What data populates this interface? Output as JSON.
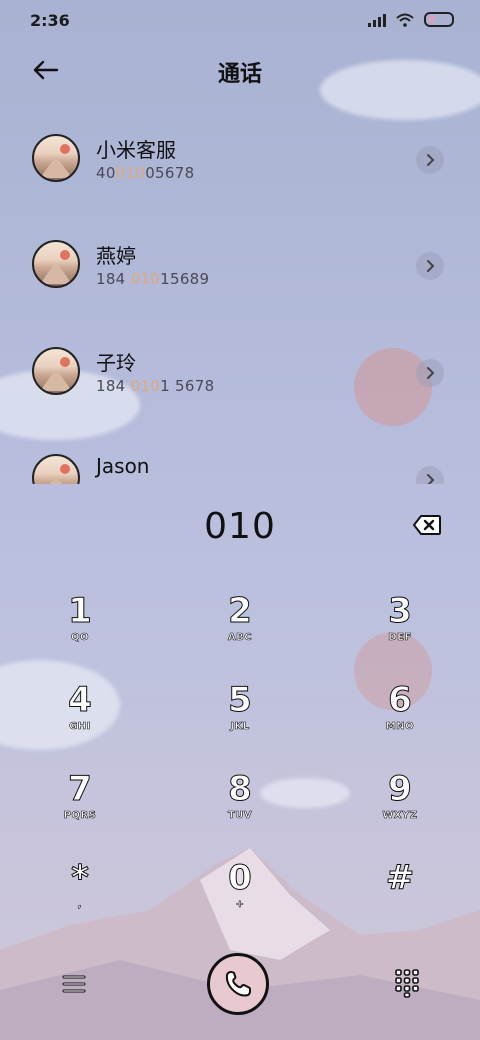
{
  "status": {
    "time": "2:36"
  },
  "header": {
    "title": "通话"
  },
  "contacts": [
    {
      "name": "小米客服",
      "num_pre": "40",
      "num_hl": "010",
      "num_post": "05678"
    },
    {
      "name": "燕婷",
      "num_pre": "184 ",
      "num_hl": "010",
      "num_post": "15689"
    },
    {
      "name": "子玲",
      "num_pre": "184 ",
      "num_hl": "010",
      "num_post": "1 5678"
    },
    {
      "name": "Jason",
      "num_pre": "",
      "num_hl": "",
      "num_post": ""
    }
  ],
  "dialer": {
    "digits": "010"
  },
  "keys": [
    {
      "num": "1",
      "letters": "QO"
    },
    {
      "num": "2",
      "letters": "ABC"
    },
    {
      "num": "3",
      "letters": "DEF"
    },
    {
      "num": "4",
      "letters": "GHI"
    },
    {
      "num": "5",
      "letters": "JKL"
    },
    {
      "num": "6",
      "letters": "MNO"
    },
    {
      "num": "7",
      "letters": "PQRS"
    },
    {
      "num": "8",
      "letters": "TUV"
    },
    {
      "num": "9",
      "letters": "WXYZ"
    },
    {
      "num": "*",
      "letters": ","
    },
    {
      "num": "0",
      "letters": "+"
    },
    {
      "num": "#",
      "letters": ""
    }
  ],
  "colors": {
    "highlight": "#e0a878",
    "call_button": "#e8c9cf"
  },
  "icons": {
    "back": "arrow-left-icon",
    "chevron": "chevron-right-icon",
    "delete": "backspace-icon",
    "menu": "menu-icon",
    "call": "phone-icon",
    "keypad": "dialpad-icon"
  }
}
